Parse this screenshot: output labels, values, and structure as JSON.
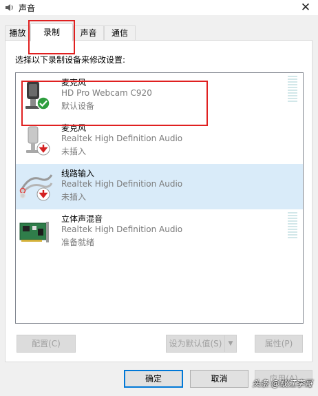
{
  "window": {
    "title": "声音",
    "close_glyph": "✕"
  },
  "tabs": [
    {
      "label": "播放"
    },
    {
      "label": "录制"
    },
    {
      "label": "声音"
    },
    {
      "label": "通信"
    }
  ],
  "active_tab": "录制",
  "instruction": "选择以下录制设备来修改设置:",
  "devices": [
    {
      "name": "麦克风",
      "description": "HD Pro Webcam C920",
      "status": "默认设备",
      "icon": "webcam-microphone-icon",
      "badge": "default-check-icon",
      "has_meter": true,
      "selected": false
    },
    {
      "name": "麦克风",
      "description": "Realtek High Definition Audio",
      "status": "未插入",
      "icon": "microphone-icon",
      "badge": "unplugged-arrow-icon",
      "has_meter": false,
      "selected": false
    },
    {
      "name": "线路输入",
      "description": "Realtek High Definition Audio",
      "status": "未插入",
      "icon": "line-in-cable-icon",
      "badge": "unplugged-arrow-icon",
      "has_meter": false,
      "selected": true
    },
    {
      "name": "立体声混音",
      "description": "Realtek High Definition Audio",
      "status": "准备就绪",
      "icon": "sound-card-icon",
      "badge": "",
      "has_meter": true,
      "selected": false
    }
  ],
  "buttons": {
    "configure": "配置(C)",
    "set_default": "设为默认值(S)",
    "properties": "属性(P)",
    "ok": "确定",
    "cancel": "取消",
    "apply": "应用(A)"
  },
  "watermark": "头条 @蚁江李哥",
  "colors": {
    "selection": "#d9ebf9",
    "highlight_box": "#e02020",
    "default_badge": "#2e9e3e",
    "unplugged_badge": "#d42020",
    "focus_border": "#0078d7"
  }
}
